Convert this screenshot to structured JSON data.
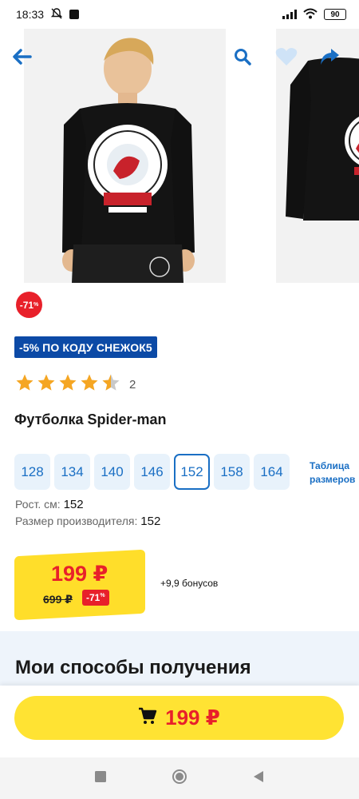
{
  "status_bar": {
    "time": "18:33",
    "battery": "90",
    "icons": [
      "muted-notifications-icon",
      "app-icon",
      "signal-icon",
      "wifi-icon",
      "battery-icon"
    ]
  },
  "header": {
    "icons": [
      "back-arrow-icon",
      "search-icon",
      "heart-icon",
      "share-icon"
    ]
  },
  "product": {
    "discount_badge": "-71",
    "discount_badge_unit": "%",
    "promo": "-5% ПО КОДУ СНЕЖОК5",
    "rating": 4.5,
    "reviews_count": "2",
    "title": "Футболка Spider-man"
  },
  "sizes": {
    "options": [
      "128",
      "134",
      "140",
      "146",
      "152",
      "158",
      "164"
    ],
    "selected": "152",
    "table_link_line1": "Таблица",
    "table_link_line2": "размеров"
  },
  "specs": {
    "height_label": "Рост. см:",
    "height_value": "152",
    "manufacturer_label": "Размер производителя:",
    "manufacturer_value": "152"
  },
  "price": {
    "current": "199 ₽",
    "old": "699 ₽",
    "discount": "-71",
    "discount_unit": "%",
    "bonus": "+9,9 бонусов"
  },
  "delivery": {
    "title": "Мои способы получения"
  },
  "buy_button": {
    "price": "199 ₽",
    "icon": "cart-icon"
  },
  "nav": {
    "icons": [
      "recents-icon",
      "home-icon",
      "back-icon"
    ]
  },
  "colors": {
    "accent_blue": "#1a6fc4",
    "promo_blue": "#0c4aa6",
    "sale_red": "#e8202a",
    "yellow": "#ffde2a",
    "star": "#f5a623"
  }
}
